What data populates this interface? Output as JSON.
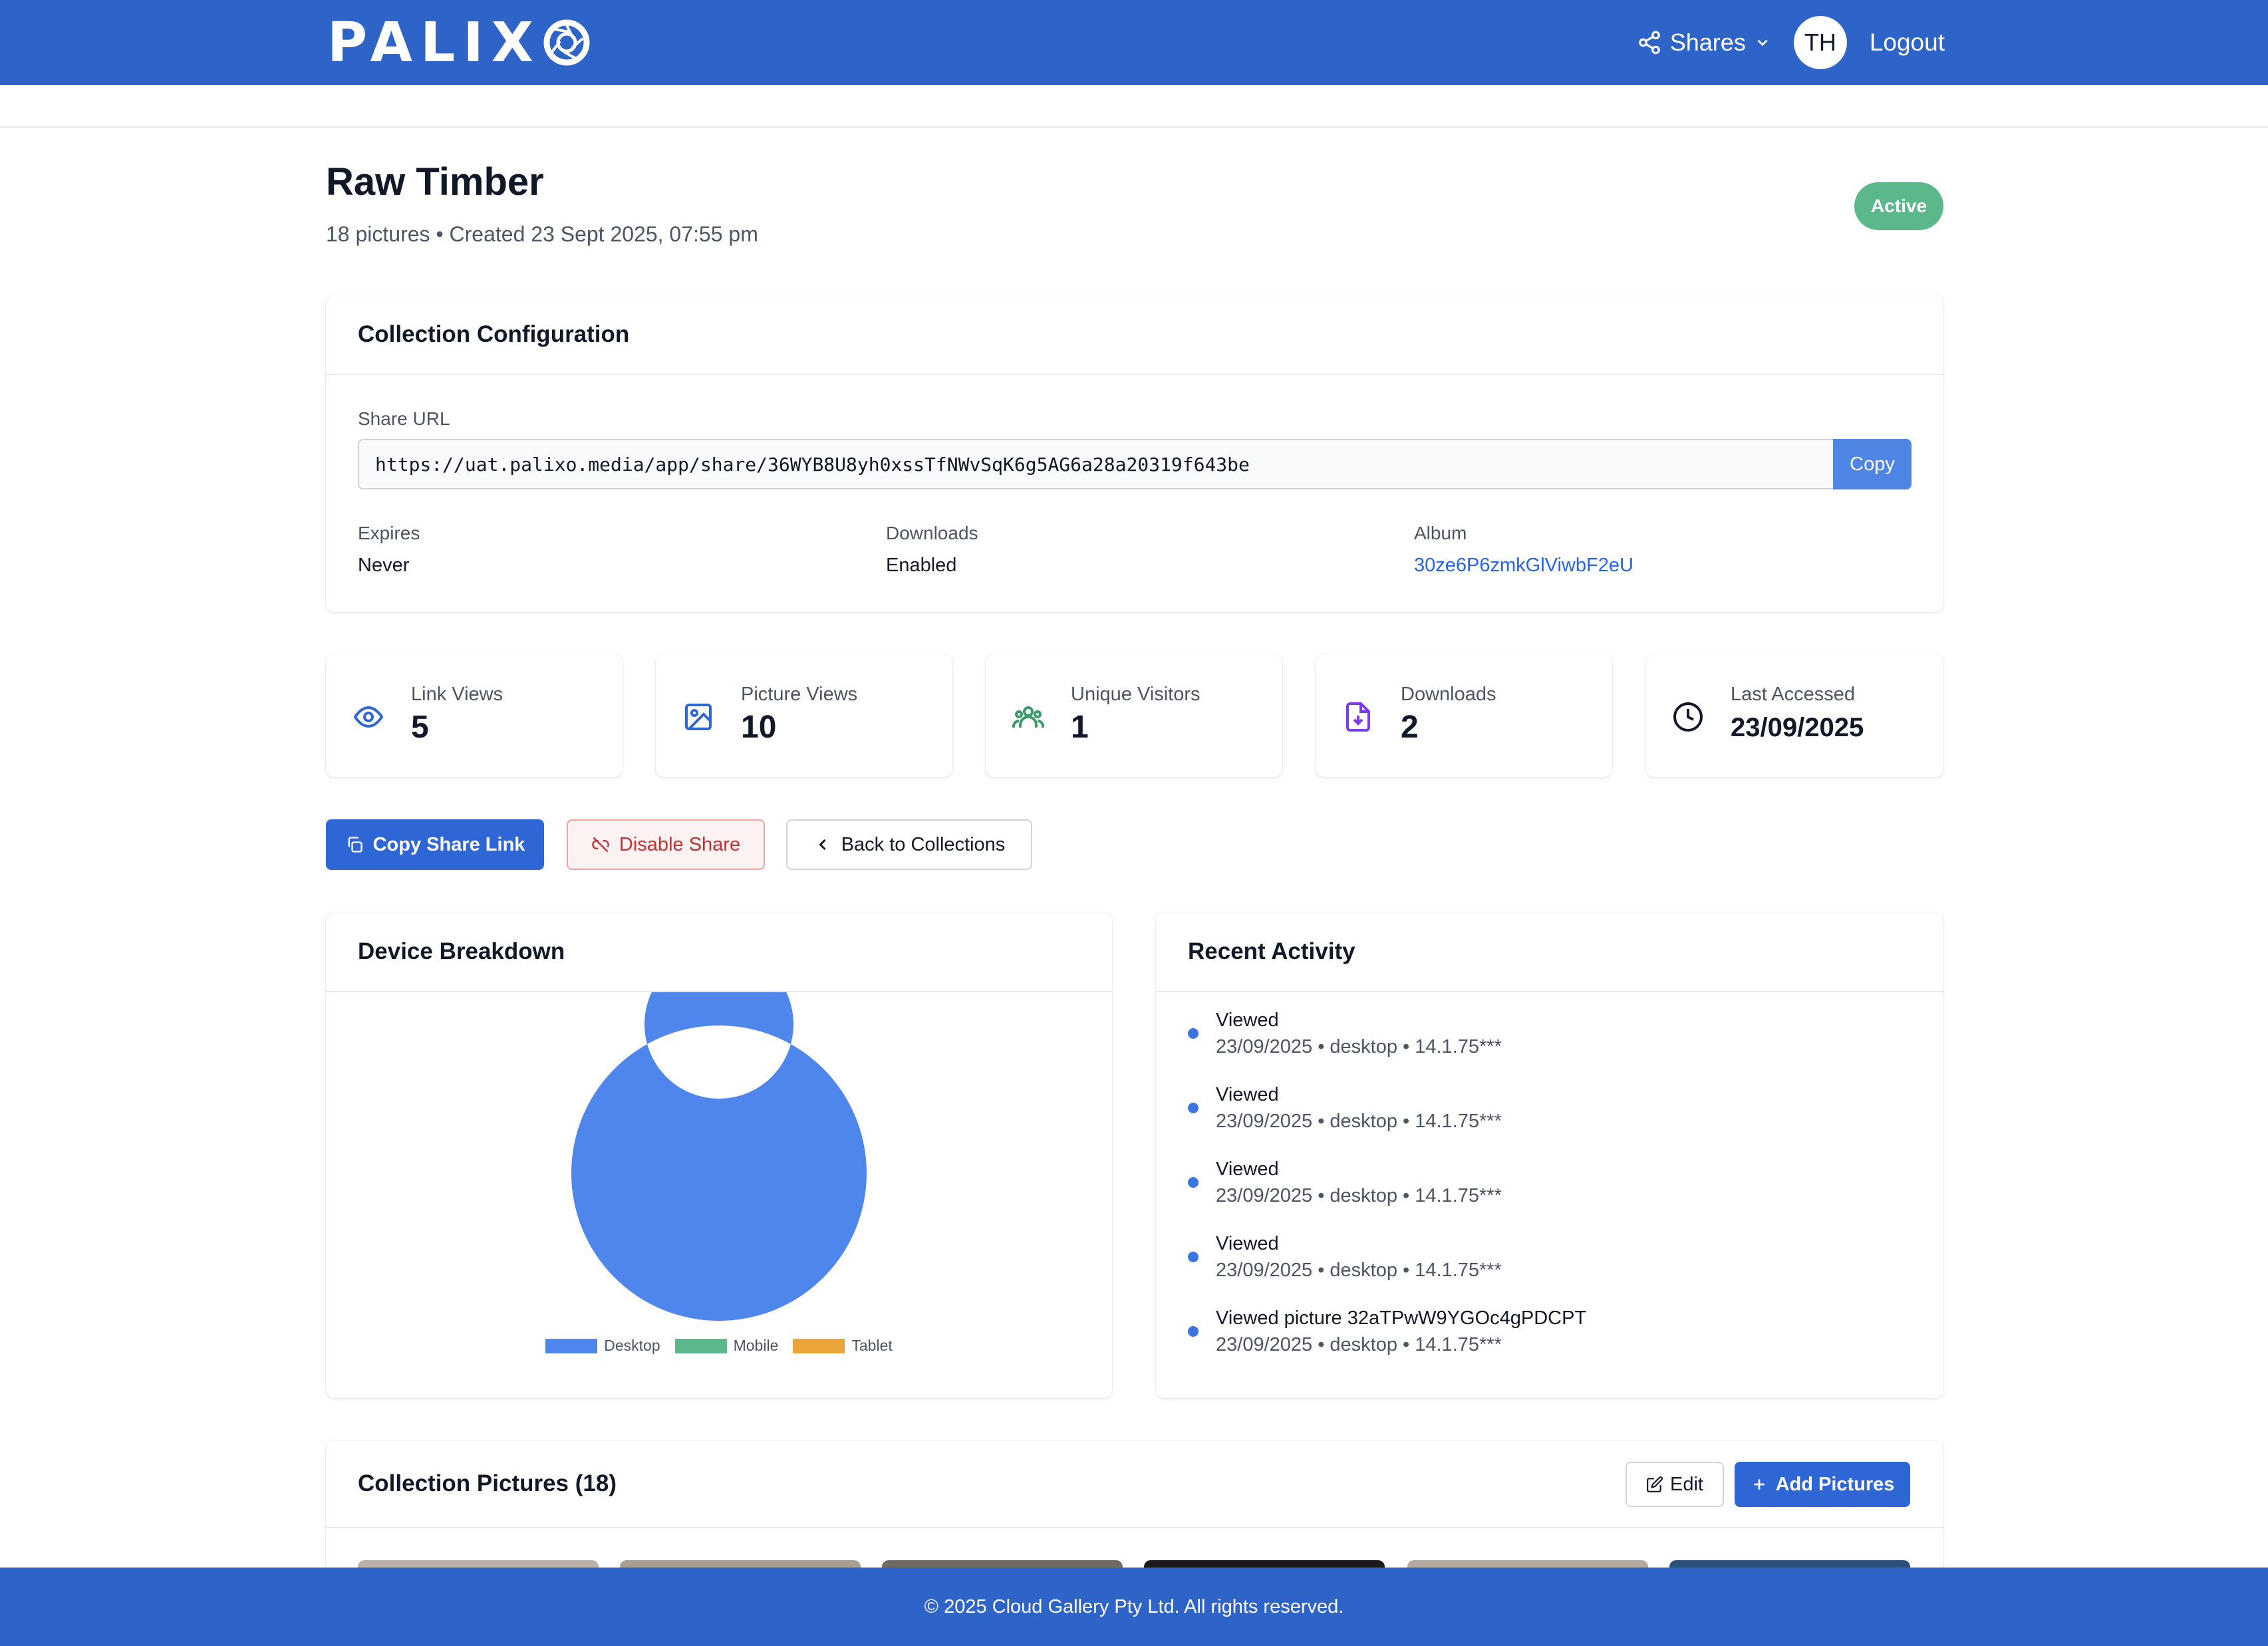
{
  "header": {
    "logo_text": "PALIX",
    "shares_label": "Shares",
    "avatar_initials": "TH",
    "logout_label": "Logout"
  },
  "collection": {
    "title": "Raw Timber",
    "meta": "18 pictures • Created 23 Sept 2025, 07:55 pm",
    "status": "Active"
  },
  "config": {
    "heading": "Collection Configuration",
    "share_url_label": "Share URL",
    "share_url": "https://uat.palixo.media/app/share/36WYB8U8yh0xssTfNWvSqK6g5AG6a28a20319f643be",
    "copy_label": "Copy",
    "expires_label": "Expires",
    "expires_value": "Never",
    "downloads_label": "Downloads",
    "downloads_value": "Enabled",
    "album_label": "Album",
    "album_value": "30ze6P6zmkGlViwbF2eU"
  },
  "stats": [
    {
      "label": "Link Views",
      "value": "5",
      "icon": "eye-icon"
    },
    {
      "label": "Picture Views",
      "value": "10",
      "icon": "image-icon"
    },
    {
      "label": "Unique Visitors",
      "value": "1",
      "icon": "users-icon"
    },
    {
      "label": "Downloads",
      "value": "2",
      "icon": "file-download-icon"
    },
    {
      "label": "Last Accessed",
      "value": "23/09/2025",
      "icon": "clock-icon"
    }
  ],
  "actions": {
    "copy_share_link": "Copy Share Link",
    "disable_share": "Disable Share",
    "back_to_collections": "Back to Collections"
  },
  "device_breakdown": {
    "heading": "Device Breakdown",
    "colors": {
      "Desktop": "#4f86ec",
      "Mobile": "#5bb88a",
      "Tablet": "#eaa43a"
    }
  },
  "chart_data": {
    "type": "pie",
    "categories": [
      "Desktop",
      "Mobile",
      "Tablet"
    ],
    "values": [
      100,
      0,
      0
    ],
    "title": "",
    "legend": "bottom"
  },
  "activity": {
    "heading": "Recent Activity",
    "items": [
      {
        "title": "Viewed",
        "meta": "23/09/2025 • desktop • 14.1.75***"
      },
      {
        "title": "Viewed",
        "meta": "23/09/2025 • desktop • 14.1.75***"
      },
      {
        "title": "Viewed",
        "meta": "23/09/2025 • desktop • 14.1.75***"
      },
      {
        "title": "Viewed",
        "meta": "23/09/2025 • desktop • 14.1.75***"
      },
      {
        "title": "Viewed picture 32aTPwW9YGOc4gPDCPT",
        "meta": "23/09/2025 • desktop • 14.1.75***"
      }
    ]
  },
  "pictures": {
    "heading": "Collection Pictures (18)",
    "edit_label": "Edit",
    "add_label": "Add Pictures"
  },
  "footer": {
    "text": "© 2025 Cloud Gallery Pty Ltd. All rights reserved."
  }
}
